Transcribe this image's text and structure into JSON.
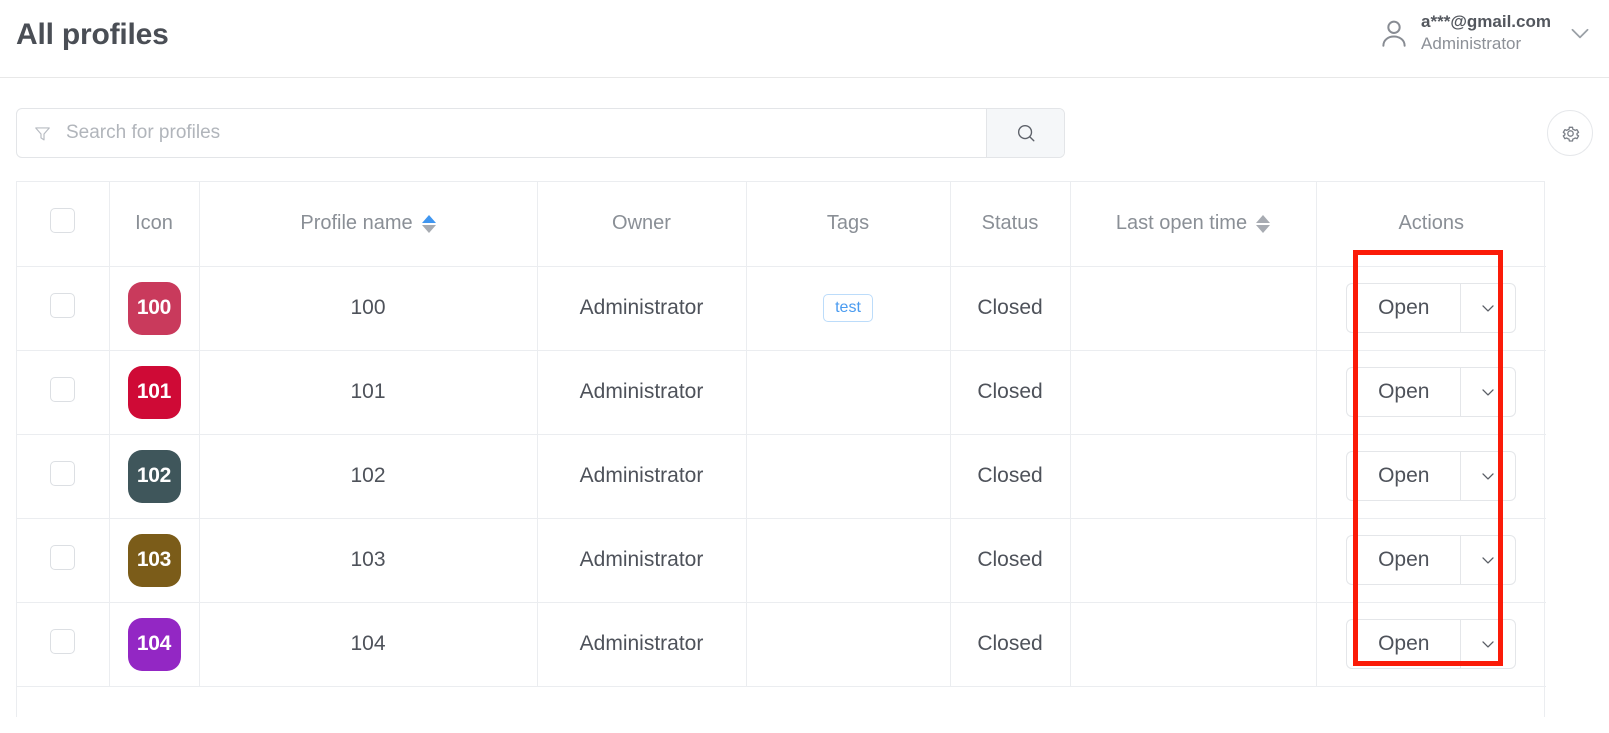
{
  "header": {
    "title": "All profiles",
    "user": {
      "email": "a***@gmail.com",
      "role": "Administrator",
      "avatar_icon": "user-circle-icon",
      "caret_icon": "chevron-down-icon"
    }
  },
  "toolbar": {
    "search": {
      "placeholder": "Search for profiles",
      "value": "",
      "filter_icon": "funnel-filter-icon",
      "button_icon": "search-magnifier-icon"
    },
    "settings_button_icon": "gear-icon"
  },
  "table": {
    "columns": [
      {
        "key": "select",
        "label": "",
        "sortable": false
      },
      {
        "key": "icon",
        "label": "Icon",
        "sortable": false
      },
      {
        "key": "name",
        "label": "Profile name",
        "sortable": true,
        "sort_state": "asc"
      },
      {
        "key": "owner",
        "label": "Owner",
        "sortable": false
      },
      {
        "key": "tags",
        "label": "Tags",
        "sortable": false
      },
      {
        "key": "status",
        "label": "Status",
        "sortable": false
      },
      {
        "key": "time",
        "label": "Last open time",
        "sortable": true,
        "sort_state": "none"
      },
      {
        "key": "actions",
        "label": "Actions",
        "sortable": false
      }
    ],
    "rows": [
      {
        "checked": false,
        "icon_label": "100",
        "icon_color": "#c93a5c",
        "name": "100",
        "owner": "Administrator",
        "tags": [
          "test"
        ],
        "status": "Closed",
        "last_open_time": "",
        "action_label": "Open"
      },
      {
        "checked": false,
        "icon_label": "101",
        "icon_color": "#cf0a36",
        "name": "101",
        "owner": "Administrator",
        "tags": [],
        "status": "Closed",
        "last_open_time": "",
        "action_label": "Open"
      },
      {
        "checked": false,
        "icon_label": "102",
        "icon_color": "#3f565b",
        "name": "102",
        "owner": "Administrator",
        "tags": [],
        "status": "Closed",
        "last_open_time": "",
        "action_label": "Open"
      },
      {
        "checked": false,
        "icon_label": "103",
        "icon_color": "#7b5c19",
        "name": "103",
        "owner": "Administrator",
        "tags": [],
        "status": "Closed",
        "last_open_time": "",
        "action_label": "Open"
      },
      {
        "checked": false,
        "icon_label": "104",
        "icon_color": "#9327c4",
        "name": "104",
        "owner": "Administrator",
        "tags": [],
        "status": "Closed",
        "last_open_time": "",
        "action_label": "Open"
      }
    ],
    "row_action_caret_icon": "chevron-down-icon"
  },
  "annotation": {
    "color": "#fb1b08",
    "target": "actions-open-button-column"
  },
  "colors": {
    "accent_blue": "#4096f0",
    "tag_blue": "#4a9bf0",
    "text_primary": "#4e525a",
    "text_muted": "#8a8f96",
    "border": "#ebedf0"
  }
}
